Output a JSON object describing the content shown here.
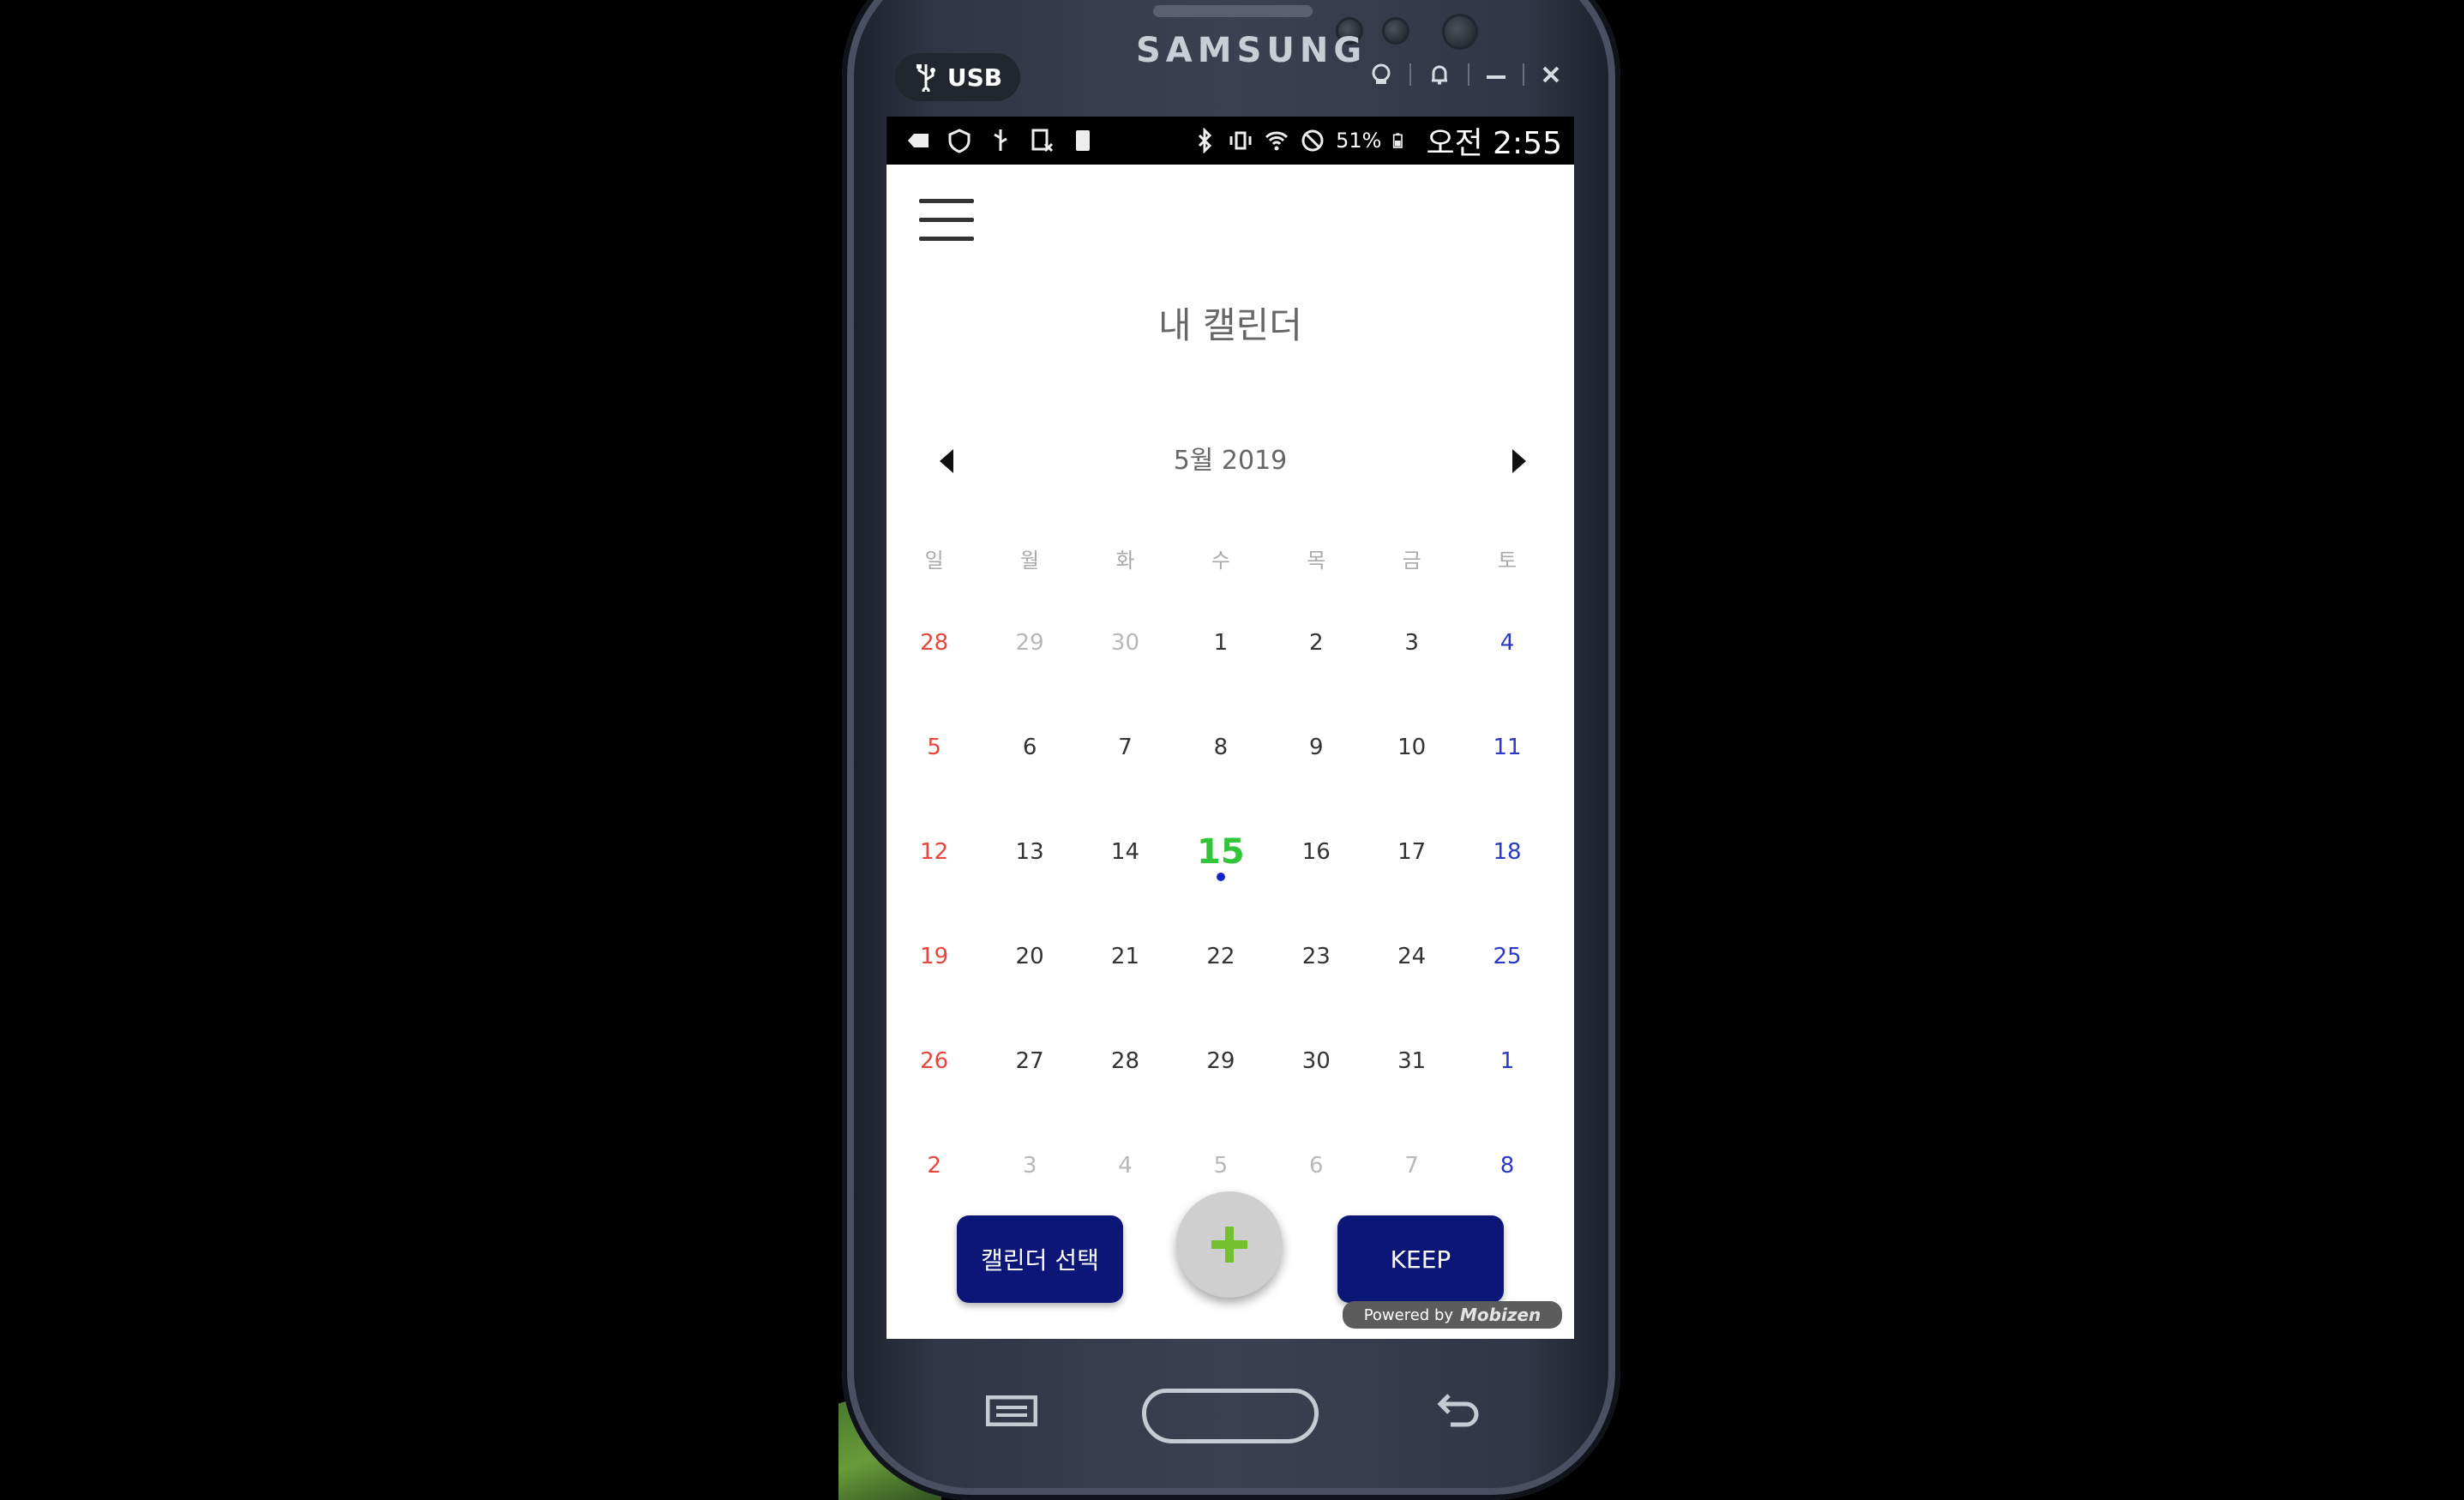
{
  "device": {
    "brand": "SAMSUNG",
    "usb_label": "USB"
  },
  "statusbar": {
    "battery_percent": "51%",
    "time": "오전 2:55"
  },
  "app": {
    "title": "내 캘린더"
  },
  "calendar": {
    "month_label": "5월 2019",
    "weekdays": [
      "일",
      "월",
      "화",
      "수",
      "목",
      "금",
      "토"
    ],
    "weeks": [
      [
        {
          "day": "28",
          "kind": "sun"
        },
        {
          "day": "29",
          "kind": "faded"
        },
        {
          "day": "30",
          "kind": "faded"
        },
        {
          "day": "1",
          "kind": "normal"
        },
        {
          "day": "2",
          "kind": "normal"
        },
        {
          "day": "3",
          "kind": "normal"
        },
        {
          "day": "4",
          "kind": "sat"
        }
      ],
      [
        {
          "day": "5",
          "kind": "sun"
        },
        {
          "day": "6",
          "kind": "normal"
        },
        {
          "day": "7",
          "kind": "normal"
        },
        {
          "day": "8",
          "kind": "normal"
        },
        {
          "day": "9",
          "kind": "normal"
        },
        {
          "day": "10",
          "kind": "normal"
        },
        {
          "day": "11",
          "kind": "sat"
        }
      ],
      [
        {
          "day": "12",
          "kind": "sun"
        },
        {
          "day": "13",
          "kind": "normal"
        },
        {
          "day": "14",
          "kind": "normal"
        },
        {
          "day": "15",
          "kind": "today",
          "event_dot": true
        },
        {
          "day": "16",
          "kind": "normal"
        },
        {
          "day": "17",
          "kind": "normal"
        },
        {
          "day": "18",
          "kind": "sat"
        }
      ],
      [
        {
          "day": "19",
          "kind": "sun"
        },
        {
          "day": "20",
          "kind": "normal"
        },
        {
          "day": "21",
          "kind": "normal"
        },
        {
          "day": "22",
          "kind": "normal"
        },
        {
          "day": "23",
          "kind": "normal"
        },
        {
          "day": "24",
          "kind": "normal"
        },
        {
          "day": "25",
          "kind": "sat"
        }
      ],
      [
        {
          "day": "26",
          "kind": "sun"
        },
        {
          "day": "27",
          "kind": "normal"
        },
        {
          "day": "28",
          "kind": "normal"
        },
        {
          "day": "29",
          "kind": "normal"
        },
        {
          "day": "30",
          "kind": "normal"
        },
        {
          "day": "31",
          "kind": "normal"
        },
        {
          "day": "1",
          "kind": "sat"
        }
      ],
      [
        {
          "day": "2",
          "kind": "sun"
        },
        {
          "day": "3",
          "kind": "faded"
        },
        {
          "day": "4",
          "kind": "faded"
        },
        {
          "day": "5",
          "kind": "faded"
        },
        {
          "day": "6",
          "kind": "faded"
        },
        {
          "day": "7",
          "kind": "faded"
        },
        {
          "day": "8",
          "kind": "sat"
        }
      ]
    ]
  },
  "actions": {
    "select_calendar_label": "캘린더 선택",
    "keep_label": "KEEP",
    "add_icon": "plus-icon"
  },
  "footer": {
    "powered_by": "Powered by",
    "powered_logo": "Mobizen"
  },
  "colors": {
    "button_bg": "#0c1676",
    "sunday": "#e8453c",
    "saturday": "#2c38c9",
    "today": "#32c53a",
    "event_dot": "#1523c8"
  }
}
